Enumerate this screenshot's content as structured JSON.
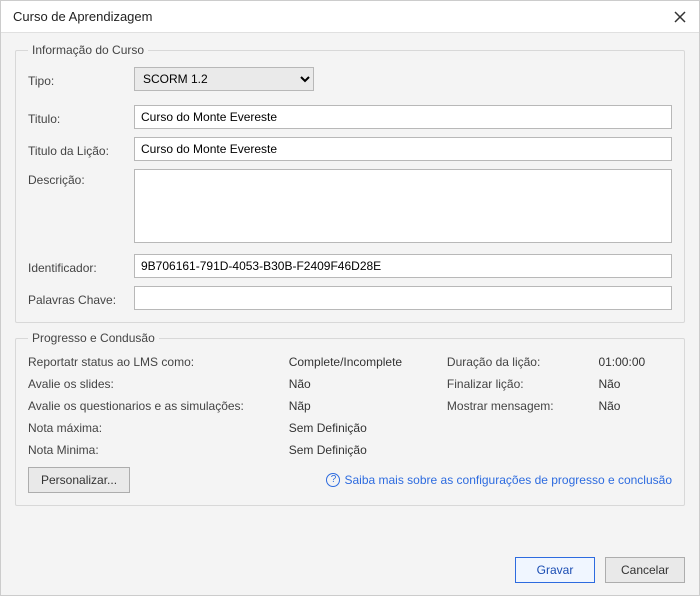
{
  "dialog": {
    "title": "Curso de Aprendizagem"
  },
  "course_info": {
    "legend": "Informação do Curso",
    "type_label": "Tipo:",
    "type_value": "SCORM 1.2",
    "title_label": "Titulo:",
    "title_value": "Curso do Monte Evereste",
    "lesson_title_label": "Titulo da Lição:",
    "lesson_title_value": "Curso do Monte Evereste",
    "description_label": "Descrição:",
    "description_value": "",
    "identifier_label": "Identificador:",
    "identifier_value": "9B706161-791D-4053-B30B-F2409F46D28E",
    "keywords_label": "Palavras Chave:",
    "keywords_value": ""
  },
  "progress": {
    "legend": "Progresso e Condusão",
    "rows": {
      "report_label": "Reportatr status ao LMS como:",
      "report_value": "Complete/Incomplete",
      "duration_label": "Duração da lição:",
      "duration_value": "01:00:00",
      "eval_slides_label": "Avalie os slides:",
      "eval_slides_value": "Não",
      "finish_lesson_label": "Finalizar lição:",
      "finish_lesson_value": "Não",
      "eval_quiz_label": "Avalie os questionarios e as simulações:",
      "eval_quiz_value": "Nãp",
      "show_message_label": "Mostrar mensagem:",
      "show_message_value": "Não",
      "max_grade_label": "Nota máxima:",
      "max_grade_value": "Sem Definição",
      "min_grade_label": "Nota Minima:",
      "min_grade_value": "Sem Definição"
    },
    "customize_label": "Personalizar...",
    "learn_more": "Saiba mais sobre as configurações de progresso e conclusão"
  },
  "footer": {
    "save": "Gravar",
    "cancel": "Cancelar"
  }
}
